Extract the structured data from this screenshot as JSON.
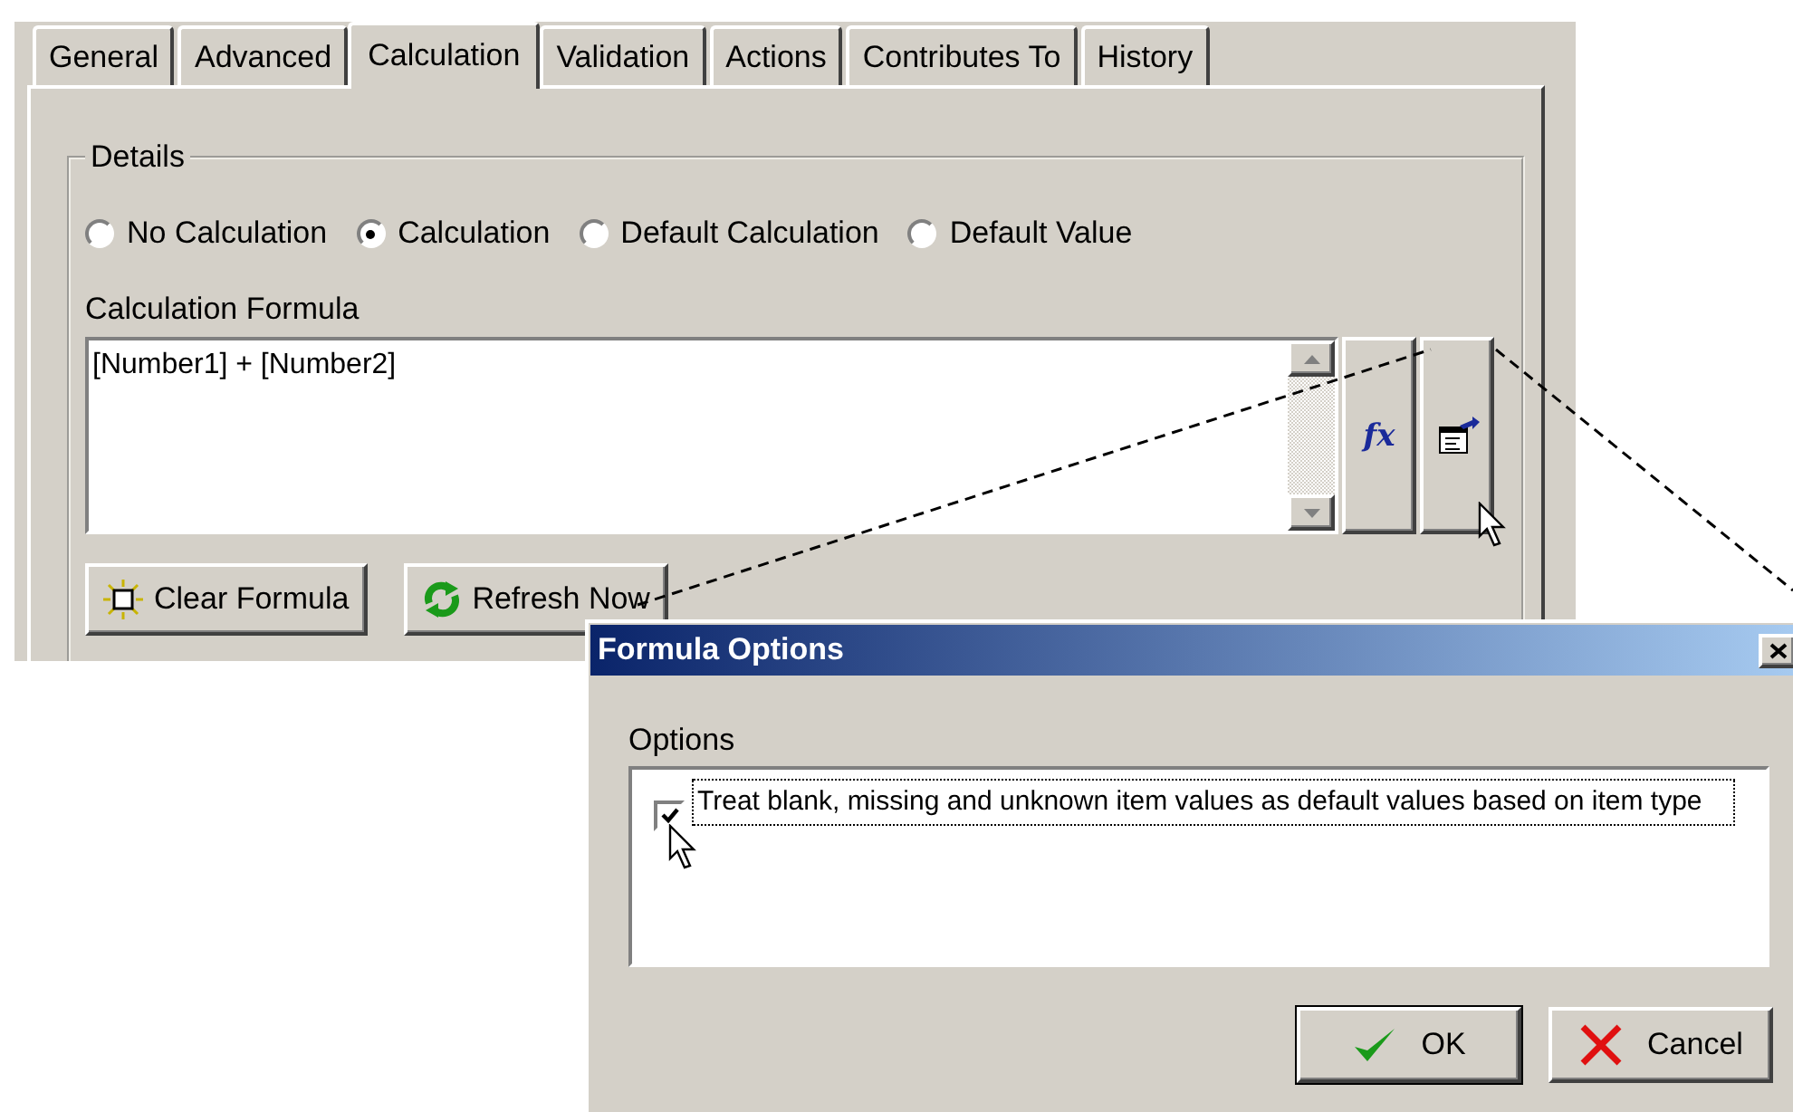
{
  "main": {
    "tabs": [
      {
        "label": "General",
        "selected": false
      },
      {
        "label": "Advanced",
        "selected": false
      },
      {
        "label": "Calculation",
        "selected": true
      },
      {
        "label": "Validation",
        "selected": false
      },
      {
        "label": "Actions",
        "selected": false
      },
      {
        "label": "Contributes To",
        "selected": false
      },
      {
        "label": "History",
        "selected": false
      }
    ],
    "group_title": "Details",
    "radios": [
      {
        "label": "No Calculation",
        "selected": false
      },
      {
        "label": "Calculation",
        "selected": true
      },
      {
        "label": "Default Calculation",
        "selected": false
      },
      {
        "label": "Default Value",
        "selected": false
      }
    ],
    "formula": {
      "label": "Calculation Formula",
      "value": "[Number1] + [Number2]"
    },
    "side_buttons": [
      {
        "kind": "function",
        "label": "fx"
      },
      {
        "kind": "properties"
      }
    ],
    "buttons": [
      {
        "kind": "clear",
        "label": "Clear Formula"
      },
      {
        "kind": "refresh",
        "label": "Refresh Now"
      }
    ]
  },
  "dialog": {
    "title": "Formula Options",
    "options_label": "Options",
    "options": [
      {
        "label": "Treat blank, missing and unknown item values as default values based on item type",
        "checked": true
      }
    ],
    "buttons": [
      {
        "kind": "ok",
        "label": "OK"
      },
      {
        "kind": "cancel",
        "label": "Cancel"
      }
    ]
  }
}
